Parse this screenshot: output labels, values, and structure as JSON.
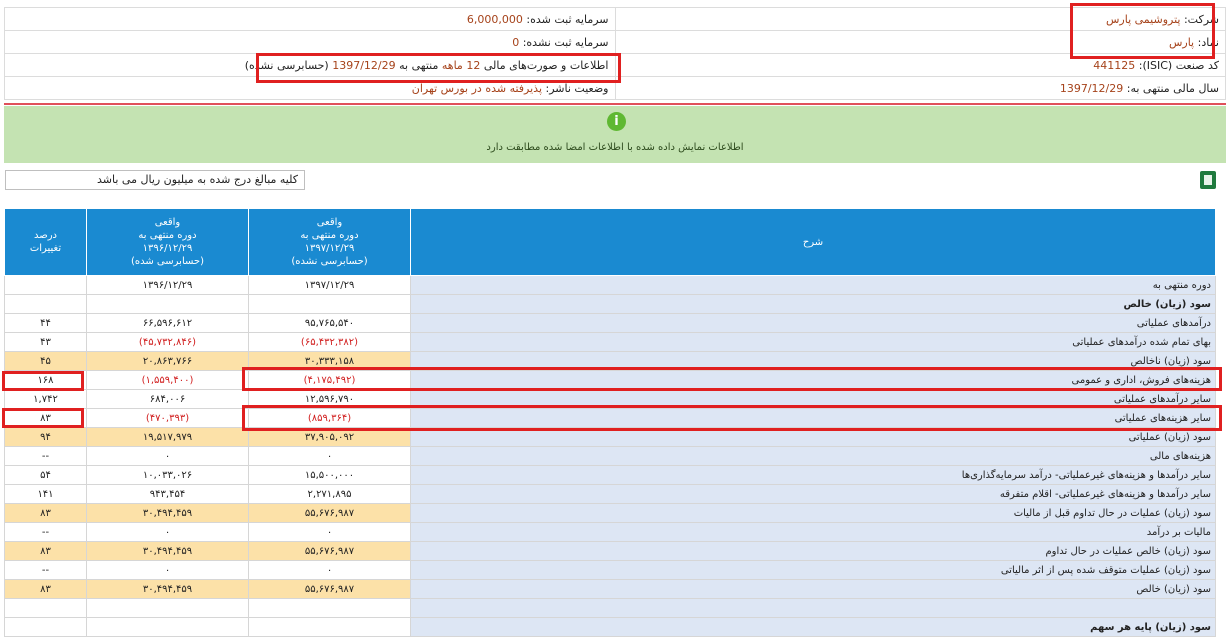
{
  "info": {
    "company_label": "شرکت:",
    "company_value": "پتروشیمی پارس",
    "symbol_label": "نماد:",
    "symbol_value": "پارس",
    "isic_label": "کد صنعت (ISIC):",
    "isic_value": "441125",
    "fiscal_year_label": "سال مالی منتهی به:",
    "fiscal_year_value": "1397/12/29",
    "registered_capital_label": "سرمایه ثبت شده:",
    "registered_capital_value": "6,000,000",
    "unregistered_capital_label": "سرمایه ثبت نشده:",
    "unregistered_capital_value": "0",
    "statement_prefix": "اطلاعات و صورت‌های مالی",
    "statement_months": "12 ماهه",
    "statement_ending": "منتهی به",
    "statement_date": "1397/12/29",
    "statement_audit": "(حسابرسی نشده)",
    "publisher_label": "وضعیت ناشر:",
    "publisher_value": "پذیرفته شده در بورس تهران"
  },
  "banner": {
    "icon": "info-icon",
    "icon_glyph": "i",
    "message": "اطلاعات نمایش داده شده با اطلاعات امضا شده مطابقت دارد"
  },
  "unit_note": "کلیه مبالغ درج شده به میلیون ریال می باشد",
  "table": {
    "headers": {
      "desc": "شرح",
      "current": [
        "واقعی",
        "دوره منتهی به",
        "۱۳۹۷/۱۲/۲۹",
        "(حسابرسی نشده)"
      ],
      "previous": [
        "واقعی",
        "دوره منتهی به",
        "۱۳۹۶/۱۲/۲۹",
        "(حسابرسی شده)"
      ],
      "change": [
        "درصد",
        "تغییرات"
      ]
    },
    "rows": [
      {
        "desc": "دوره منتهی به",
        "cur": "۱۳۹۷/۱۲/۲۹",
        "prev": "۱۳۹۶/۱۲/۲۹",
        "chg": "",
        "hl": false,
        "neg": false,
        "bold": false
      },
      {
        "desc": "سود (زیان) خالص",
        "cur": "",
        "prev": "",
        "chg": "",
        "hl": false,
        "neg": false,
        "bold": true
      },
      {
        "desc": "درآمدهای عملیاتی",
        "cur": "۹۵,۷۶۵,۵۴۰",
        "prev": "۶۶,۵۹۶,۶۱۲",
        "chg": "۴۴",
        "hl": false,
        "neg": false,
        "bold": false
      },
      {
        "desc": "بهای تمام شده درآمدهای عملیاتی",
        "cur": "(۶۵,۴۳۲,۳۸۲)",
        "prev": "(۴۵,۷۳۲,۸۴۶)",
        "chg": "۴۳",
        "hl": false,
        "neg": true,
        "bold": false
      },
      {
        "desc": "سود (زیان) ناخالص",
        "cur": "۳۰,۳۳۳,۱۵۸",
        "prev": "۲۰,۸۶۳,۷۶۶",
        "chg": "۴۵",
        "hl": true,
        "neg": false,
        "bold": false
      },
      {
        "desc": "هزینه‌های فروش، اداری و عمومی",
        "cur": "(۴,۱۷۵,۴۹۲)",
        "prev": "(۱,۵۵۹,۴۰۰)",
        "chg": "۱۶۸",
        "hl": false,
        "neg": true,
        "bold": false
      },
      {
        "desc": "سایر درآمدهای عملیاتی",
        "cur": "۱۲,۵۹۶,۷۹۰",
        "prev": "۶۸۴,۰۰۶",
        "chg": "۱,۷۴۲",
        "hl": false,
        "neg": false,
        "bold": false
      },
      {
        "desc": "سایر هزینه‌های عملیاتی",
        "cur": "(۸۵۹,۳۶۴)",
        "prev": "(۴۷۰,۳۹۳)",
        "chg": "۸۳",
        "hl": false,
        "neg": true,
        "bold": false
      },
      {
        "desc": "سود (زیان) عملیاتی",
        "cur": "۳۷,۹۰۵,۰۹۲",
        "prev": "۱۹,۵۱۷,۹۷۹",
        "chg": "۹۴",
        "hl": true,
        "neg": false,
        "bold": false
      },
      {
        "desc": "هزینه‌های مالی",
        "cur": "۰",
        "prev": "۰",
        "chg": "--",
        "hl": false,
        "neg": false,
        "bold": false
      },
      {
        "desc": "سایر درآمدها و هزینه‌های غیرعملیاتی- درآمد سرمایه‌گذاری‌ها",
        "cur": "۱۵,۵۰۰,۰۰۰",
        "prev": "۱۰,۰۳۳,۰۲۶",
        "chg": "۵۴",
        "hl": false,
        "neg": false,
        "bold": false
      },
      {
        "desc": "سایر درآمدها و هزینه‌های غیرعملیاتی- اقلام متفرقه",
        "cur": "۲,۲۷۱,۸۹۵",
        "prev": "۹۴۳,۴۵۴",
        "chg": "۱۴۱",
        "hl": false,
        "neg": false,
        "bold": false
      },
      {
        "desc": "سود (زیان) عملیات در حال تداوم قبل از مالیات",
        "cur": "۵۵,۶۷۶,۹۸۷",
        "prev": "۳۰,۴۹۴,۴۵۹",
        "chg": "۸۳",
        "hl": true,
        "neg": false,
        "bold": false
      },
      {
        "desc": "مالیات بر درآمد",
        "cur": "۰",
        "prev": "۰",
        "chg": "--",
        "hl": false,
        "neg": false,
        "bold": false
      },
      {
        "desc": "سود (زیان) خالص عملیات در حال تداوم",
        "cur": "۵۵,۶۷۶,۹۸۷",
        "prev": "۳۰,۴۹۴,۴۵۹",
        "chg": "۸۳",
        "hl": true,
        "neg": false,
        "bold": false
      },
      {
        "desc": "سود (زیان) عملیات متوقف شده پس از اثر مالیاتی",
        "cur": "۰",
        "prev": "۰",
        "chg": "--",
        "hl": false,
        "neg": false,
        "bold": false
      },
      {
        "desc": "سود (زیان) خالص",
        "cur": "۵۵,۶۷۶,۹۸۷",
        "prev": "۳۰,۴۹۴,۴۵۹",
        "chg": "۸۳",
        "hl": true,
        "neg": false,
        "bold": false
      },
      {
        "desc": "",
        "cur": "",
        "prev": "",
        "chg": "",
        "hl": false,
        "neg": false,
        "bold": false
      },
      {
        "desc": "سود (زیان) پایه هر سهم",
        "cur": "",
        "prev": "",
        "chg": "",
        "hl": false,
        "neg": false,
        "bold": true
      }
    ]
  },
  "colors": {
    "header_blue": "#1a8ad1",
    "highlight_row": "#fce1a8",
    "desc_bg": "#dde6f4",
    "negative": "#d12020",
    "banner_green": "#c4e3b2",
    "annotation_red": "#e02020"
  }
}
